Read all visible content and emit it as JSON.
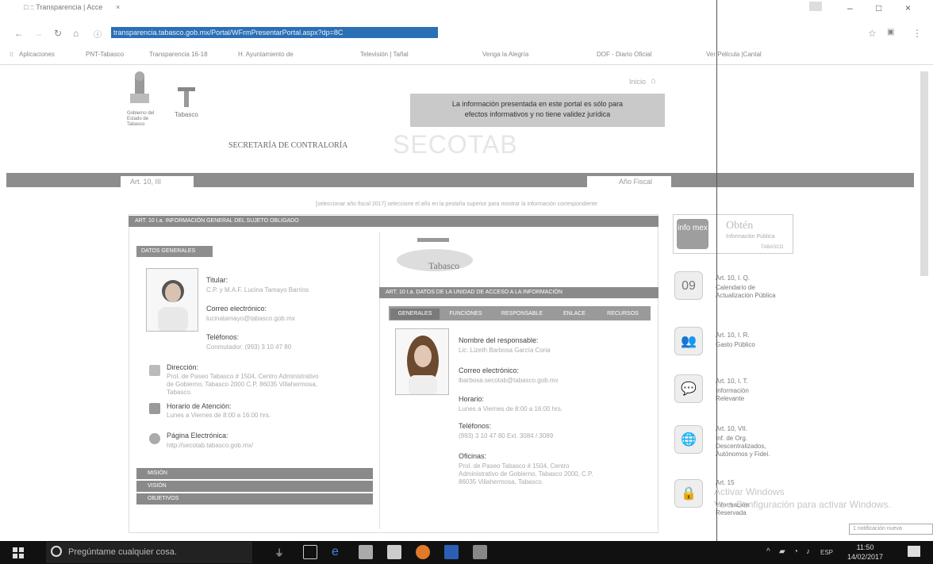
{
  "browser": {
    "tab_title": "□ :: Transparencia | Acce",
    "tab_close": "×",
    "url": "transparencia.tabasco.gob.mx/Portal/WFrmPresentarPortal.aspx?dp=8C",
    "win_min": "–",
    "win_max": "□",
    "win_close": "×",
    "bookmarks": [
      "Aplicaciones",
      "PNT-Tabasco",
      "Transparencia 16-18",
      "H. Ayuntamiento de",
      "Televisión | Tañal",
      "Venga la Alegría ",
      "DOF - Diario Oficial",
      "Ver Pelicula |Cantal"
    ]
  },
  "header": {
    "inicio": "Inicio",
    "notice_line1": "La información presentada en este portal es sólo para",
    "notice_line2": "efectos informativos y no tiene validez jurídica",
    "secretaria": "SECRETARÍA DE CONTRALORÍA",
    "acronym": "SECOTAB",
    "logo_text": "Tabasco",
    "logo_left": "Gobierno del Estado de Tabasco"
  },
  "band": {
    "left_tab": "Art. 10, III",
    "right_tab": "Año Fiscal"
  },
  "subtitle": "[seleccionar año fiscal 2017]   seleccione el año en la pestaña superior para mostrar la información correspondiente",
  "left_panel": {
    "header": "ART. 10 I.a. INFORMACIÓN GENERAL DEL SUJETO OBLIGADO",
    "section_label": "DATOS GENERALES",
    "titular_label": "Titular:",
    "titular_value": "C.P. y M.A.F. Lucina Tamayo Barrios",
    "correo_label": "Correo electrónico:",
    "correo_value": "lucinatamayo@tabasco.gob.mx",
    "telefonos_label": "Teléfonos:",
    "telefonos_value": "Conmutador: (993) 3 10 47 80",
    "direccion_label": "Dirección:",
    "direccion_value_1": "Prol. de Paseo Tabasco # 1504, Centro Administrativo",
    "direccion_value_2": "de Gobierno, Tabasco 2000 C.P. 86035 Villahermosa,",
    "direccion_value_3": "Tabasco.",
    "horario_label": "Horario de Atención:",
    "horario_value": "Lunes a Viernes de 8:00 a 16:00 hrs.",
    "pagina_label": "Página Electrónica:",
    "pagina_value": "http://secotab.tabasco.gob.mx/",
    "footer_rows": [
      "MISIÓN",
      "VISIÓN",
      "OBJETIVOS"
    ]
  },
  "right_subpanel": {
    "logo": "Tabasco",
    "header": "ART. 10 I.a. DATOS DE LA UNIDAD DE ACCESO A LA INFORMACIÓN",
    "tabs": [
      "GENERALES",
      "FUNCIONES",
      "RESPONSABLE",
      "ENLACE",
      "RECURSOS"
    ],
    "nombre_label": "Nombre del responsable:",
    "nombre_value": "Lic. Lizeth Barbosa García Coria",
    "correo_label": "Correo electrónico:",
    "correo_value": "lbarbosa.secotab@tabasco.gob.mx",
    "horario_label": "Horario:",
    "horario_value": "Lunes a Viernes de 8:00 a 16:00 hrs.",
    "telefonos_label": "Teléfonos:",
    "telefonos_value": "(993) 3 10 47 80 Ext. 3084 / 3089",
    "oficinas_label": "Oficinas:",
    "oficinas_value_1": "Prol. de Paseo Tabasco # 1504, Centro",
    "oficinas_value_2": "Administrativo de Gobierno, Tabasco 2000, C.P.",
    "oficinas_value_3": "86035 Villahermosa, Tabasco."
  },
  "sidebar": {
    "infomex_brand": "info mex",
    "infomex_title": "Obtén",
    "infomex_sub": "Información Pública",
    "infomex_tag": "TABASCO",
    "items": [
      {
        "title": "Art. 10, I. Q.",
        "desc": "Calendario de Actualización Pública",
        "icon": "09"
      },
      {
        "title": "Art. 10, I. R.",
        "desc": "Gasto Público",
        "icon": "👥"
      },
      {
        "title": "Art. 10, I. T.",
        "desc": "Información Relevante",
        "icon": "💬"
      },
      {
        "title": "Art. 10, VII.",
        "desc": "Inf. de Org. Descentralizados, Autónomos y Fidei.",
        "icon": "🌐"
      },
      {
        "title": "Art. 15",
        "desc": "Información Reservada",
        "icon": "🔒"
      }
    ]
  },
  "watermark": {
    "line1": "Activar Windows",
    "line2": "Ve a Configuración para activar Windows."
  },
  "notification_box": "1 notificación nueva",
  "taskbar": {
    "search_placeholder": "Pregúntame cualquier cosa.",
    "time": "11:50",
    "date": "14/02/2017",
    "lang": "ESP"
  }
}
